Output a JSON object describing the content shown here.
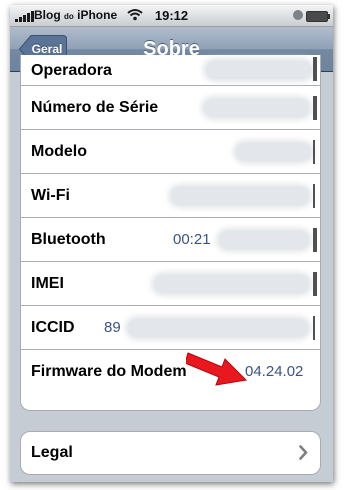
{
  "status_bar": {
    "carrier_main": "Blog",
    "carrier_small": "do",
    "carrier_end": "iPhone",
    "time": "19:12"
  },
  "nav": {
    "back_label": "Geral",
    "title": "Sobre"
  },
  "about": {
    "rows": [
      {
        "label": "Operadora",
        "value": ""
      },
      {
        "label": "Número de Série",
        "value": ""
      },
      {
        "label": "Modelo",
        "value": ""
      },
      {
        "label": "Wi-Fi",
        "value": ""
      },
      {
        "label": "Bluetooth",
        "value": "00:21"
      },
      {
        "label": "IMEI",
        "value": ""
      },
      {
        "label": "ICCID",
        "value": "89"
      },
      {
        "label": "Firmware do Modem",
        "value": "04.24.02"
      }
    ]
  },
  "legal": {
    "label": "Legal"
  },
  "colors": {
    "nav_bar": "#6d84a0",
    "value_text": "#385487",
    "annotation_arrow": "#e8181e",
    "background": "#c5ccd4"
  },
  "icons": [
    "signal-bars-icon",
    "wifi-icon",
    "lock-icon",
    "battery-icon",
    "chevron-right-icon",
    "red-arrow-icon"
  ]
}
